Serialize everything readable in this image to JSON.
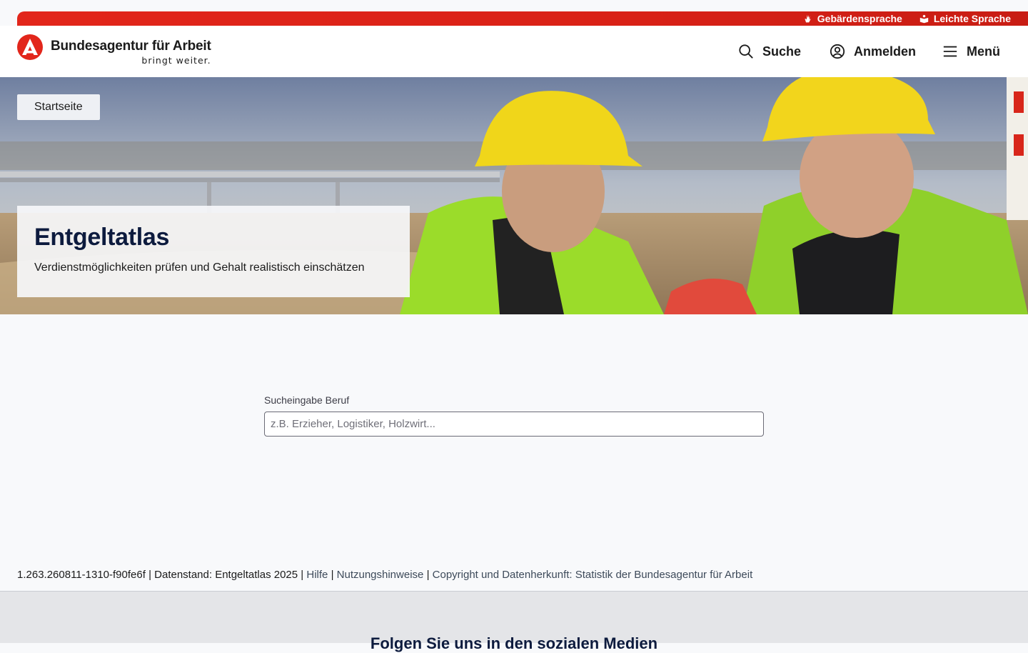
{
  "topbar": {
    "links": [
      {
        "label": "Gebärdensprache",
        "icon": "sign-language-icon"
      },
      {
        "label": "Leichte Sprache",
        "icon": "easy-language-icon"
      }
    ],
    "color": "#e2261b"
  },
  "header": {
    "logo_name": "Bundesagentur für Arbeit",
    "logo_slogan": "bringt weiter.",
    "search_label": "Suche",
    "login_label": "Anmelden",
    "menu_label": "Menü"
  },
  "hero": {
    "breadcrumb": "Startseite",
    "title": "Entgeltatlas",
    "subtitle": "Verdienstmöglichkeiten prüfen und Gehalt realistisch einschätzen"
  },
  "search": {
    "label": "Sucheingabe Beruf",
    "placeholder": "z.B. Erzieher, Logistiker, Holzwirt...",
    "value": ""
  },
  "footer": {
    "version": "1.263.260811-1310-f90fe6f",
    "datenstand": "Datenstand: Entgeltatlas 2025",
    "hilfe": "Hilfe",
    "nutzungshinweise": "Nutzungshinweise",
    "copyright": "Copyright und Datenherkunft: Statistik der Bundesagentur für Arbeit",
    "social_title": "Folgen Sie uns in den sozialen Medien"
  },
  "colors": {
    "brand_red": "#e2261b",
    "title_navy": "#0d1b3e"
  }
}
